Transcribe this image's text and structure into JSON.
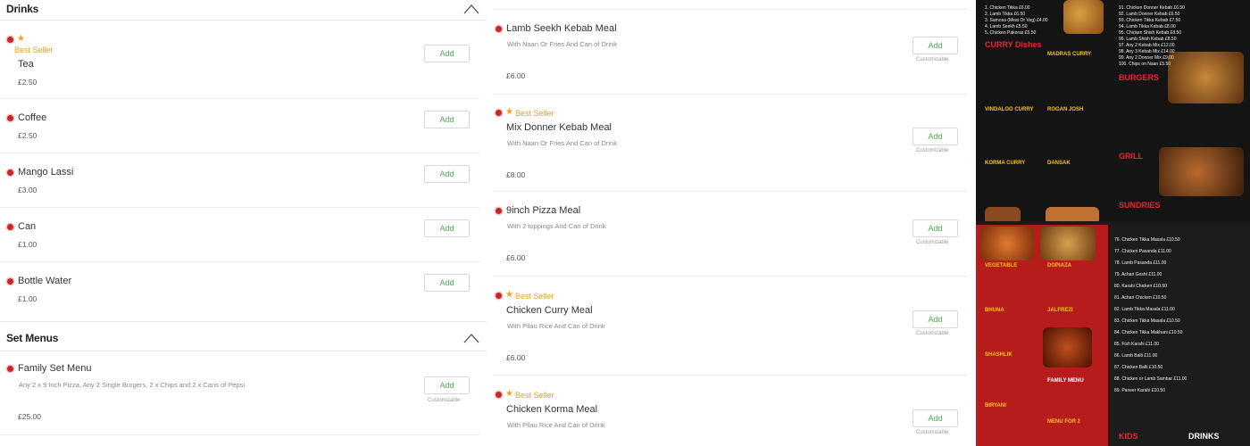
{
  "drinks": {
    "title": "Drinks",
    "items": [
      {
        "best": "Best Seller",
        "name": "Tea",
        "price": "£2.50",
        "add": "Add"
      },
      {
        "name": "Coffee",
        "price": "£2.50",
        "add": "Add"
      },
      {
        "name": "Mango Lassi",
        "price": "£3.00",
        "add": "Add"
      },
      {
        "name": "Can",
        "price": "£1.00",
        "add": "Add"
      },
      {
        "name": "Bottle Water",
        "price": "£1.00",
        "add": "Add"
      }
    ]
  },
  "set_menus": {
    "title": "Set Menus",
    "items": [
      {
        "name": "Family Set Menu",
        "desc": "Any 2 x 9 Inch Pizza, Any 2 Single Burgers, 2 x Chips and 2 x Cans of Pepsi",
        "price": "£25.00",
        "add": "Add",
        "custom": "Customizable"
      }
    ]
  },
  "meals": [
    {
      "name": "Lamb Seekh Kebab Meal",
      "desc": "With Naan Or Fries And Can of Drink",
      "price": "£6.00",
      "add": "Add",
      "custom": "Customizable"
    },
    {
      "best": "Best Seller",
      "name": "Mix Donner Kebab Meal",
      "desc": "With Naan Or Fries And Can of Drink",
      "price": "£8.00",
      "add": "Add",
      "custom": "Customizable"
    },
    {
      "name": "9inch Pizza Meal",
      "desc": "With 2 toppings And Can of Drink",
      "price": "£6.00",
      "add": "Add",
      "custom": "Customizable"
    },
    {
      "best": "Best Seller",
      "name": "Chicken Curry Meal",
      "desc": "With Pilau Rice And Can of Drink",
      "price": "£6.00",
      "add": "Add",
      "custom": "Customizable"
    },
    {
      "best": "Best Seller",
      "name": "Chicken Korma Meal",
      "desc": "With Pilau Rice And Can of Drink",
      "add": "Add",
      "custom": "Customizable"
    }
  ],
  "menu_photos": {
    "top": {
      "curry_title": "CURRY Dishes",
      "madras_title": "MADRAS CURRY",
      "vindaloo_title": "VINDALOO CURRY",
      "rogan_title": "ROGAN JOSH",
      "korma_title": "KORMA CURRY",
      "dansak_title": "DANSAK",
      "burgers_title": "BURGERS",
      "grill_title": "GRILL",
      "sundries_title": "SUNDRIES",
      "lines_left": [
        "1. Chicken Tikka £6.00",
        "2. Lamb Tikka £6.50",
        "3. Samosa (Meat Or Veg) £4.00",
        "4. Lamb Seekh £5.50",
        "5. Chicken Pakoras £5.50"
      ],
      "lines_right": [
        "91. Chicken Donner Kebab £6.50",
        "92. Lamb Donner Kebab £6.50",
        "93. Chicken Tikka Kebab £7.50",
        "94. Lamb Tikka Kebab £8.00",
        "95. Chicken Shish Kebab £8.50",
        "96. Lamb Shish Kebab £8.50",
        "97. Any 2 Kebab Mix £12.00",
        "98. Any 3 Kebab Mix £14.00",
        "99. Any 2 Donner Mix £9.00",
        "100. Chips on Naan £5.50"
      ]
    },
    "bottom": {
      "vegetable_title": "VEGETABLE",
      "dopiaza_title": "DOPIAZA",
      "bhuna_title": "BHUNA",
      "jalfrezi_title": "JALFREZI",
      "shashlik_title": "SHASHLIK",
      "biryani_title": "BIRYANI",
      "family_title": "FAMILY MENU",
      "menu2_title": "MENU FOR 2",
      "kids_title": "KIDS",
      "drinks_title": "DRINKS",
      "lines_right": [
        "76. Chicken Tikka Masala £10.50",
        "77. Chicken Pasanda £11.00",
        "78. Lamb Pasanda £11.00",
        "79. Achari Gosht £11.00",
        "80. Karahi Chicken £10.50",
        "81. Achari Chicken £10.50",
        "82. Lamb Tikka Masala £11.00",
        "83. Chicken Tikka Masala £10.50",
        "84. Chicken Tikka Makhani £10.50",
        "85. Fish Karahi £11.00",
        "86. Lamb Balti £11.00",
        "87. Chicken Balti £10.50",
        "88. Chicken or Lamb Sambar £11.00",
        "89. Paneer Karahi £10.50"
      ]
    }
  },
  "colors": {
    "accent_green": "#4caf50",
    "dot_red": "#c62828",
    "star_orange": "#f0a020"
  },
  "icons": {
    "collapse": "chevron-up-icon",
    "star": "star-icon",
    "marker": "red-dot-icon"
  }
}
